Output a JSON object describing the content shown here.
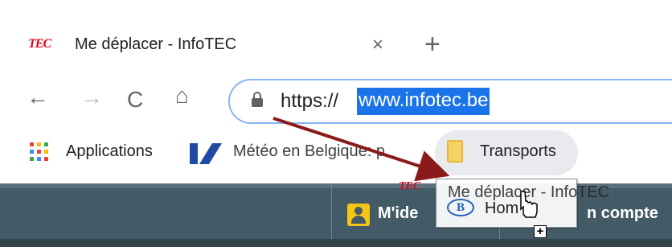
{
  "tab": {
    "favicon_text": "TEC",
    "title": "Me déplacer - InfoTEC",
    "close_glyph": "×"
  },
  "new_tab_glyph": "+",
  "toolbar": {
    "back_glyph": "←",
    "forward_glyph": "→",
    "reload_glyph": "C",
    "home_glyph": "⌂"
  },
  "omnibox": {
    "scheme": "https://",
    "host_selected": "www.infotec.be"
  },
  "bookmarks": {
    "apps_label": "Applications",
    "meteo_label": "Météo en Belgique: p",
    "transports_label": "Transports"
  },
  "site_header": {
    "login_label": "M'ide",
    "account_label": "n compte",
    "colors": {
      "background": "#435b66",
      "badge": "#f5c518"
    }
  },
  "drag_ghost": {
    "tec_text": "TEC",
    "title": "Me déplacer - InfoTEC",
    "sncb_text": "B",
    "home_label": "Hom"
  },
  "copy_badge_glyph": "+",
  "colors": {
    "selection": "#1a73e8",
    "annotation_arrow": "#8b1a1a",
    "tec_red": "#e2001a"
  }
}
